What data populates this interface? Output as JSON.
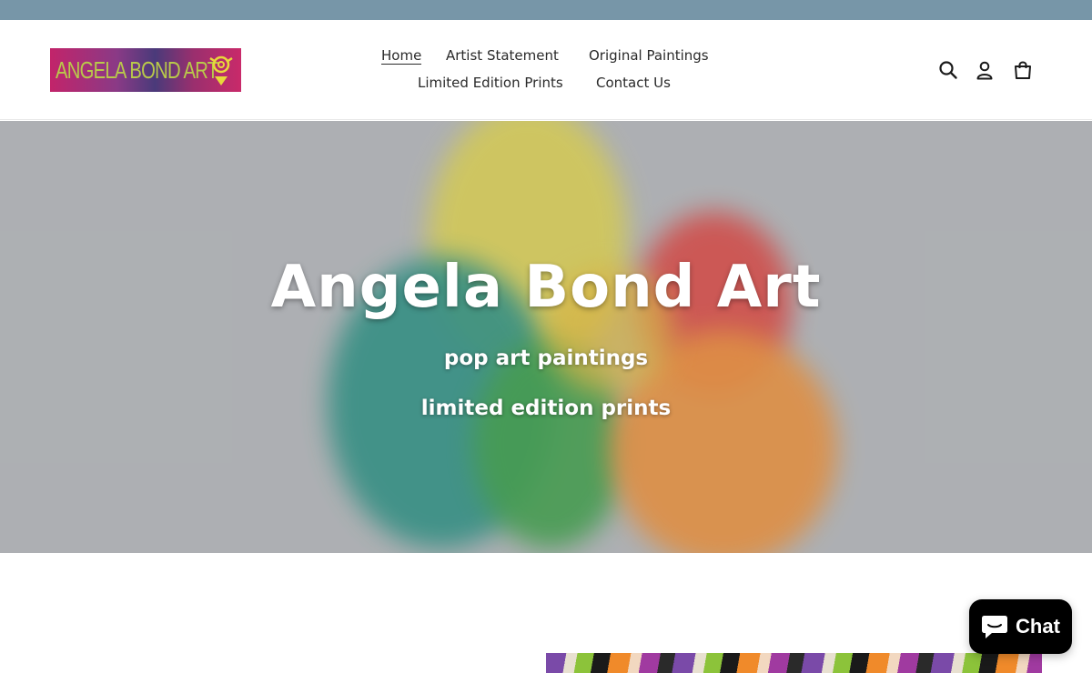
{
  "logo": {
    "text": "ANGELA BOND ART",
    "icon": "spiral-triangle-logo-icon"
  },
  "nav": {
    "home": "Home",
    "artist_statement": "Artist Statement",
    "original_paintings": "Original Paintings",
    "limited_edition_prints": "Limited Edition Prints",
    "contact_us": "Contact Us",
    "active": "Home"
  },
  "header_icons": {
    "search": "search-icon",
    "account": "user-icon",
    "cart": "cart-icon"
  },
  "hero": {
    "title": "Angela Bond Art",
    "subtitle_1": "pop art paintings",
    "subtitle_2": "limited edition prints"
  },
  "chat": {
    "label": "Chat",
    "icon": "chat-bubble-icon"
  },
  "colors": {
    "announcement_bar": "#7796a8",
    "hero_background": "#b1b3b6",
    "ink_teal": "#1a8a7a",
    "ink_yellow": "#e6d23a",
    "ink_red": "#e0302a",
    "ink_orange": "#f08a2a",
    "chat_button": "#000000"
  }
}
